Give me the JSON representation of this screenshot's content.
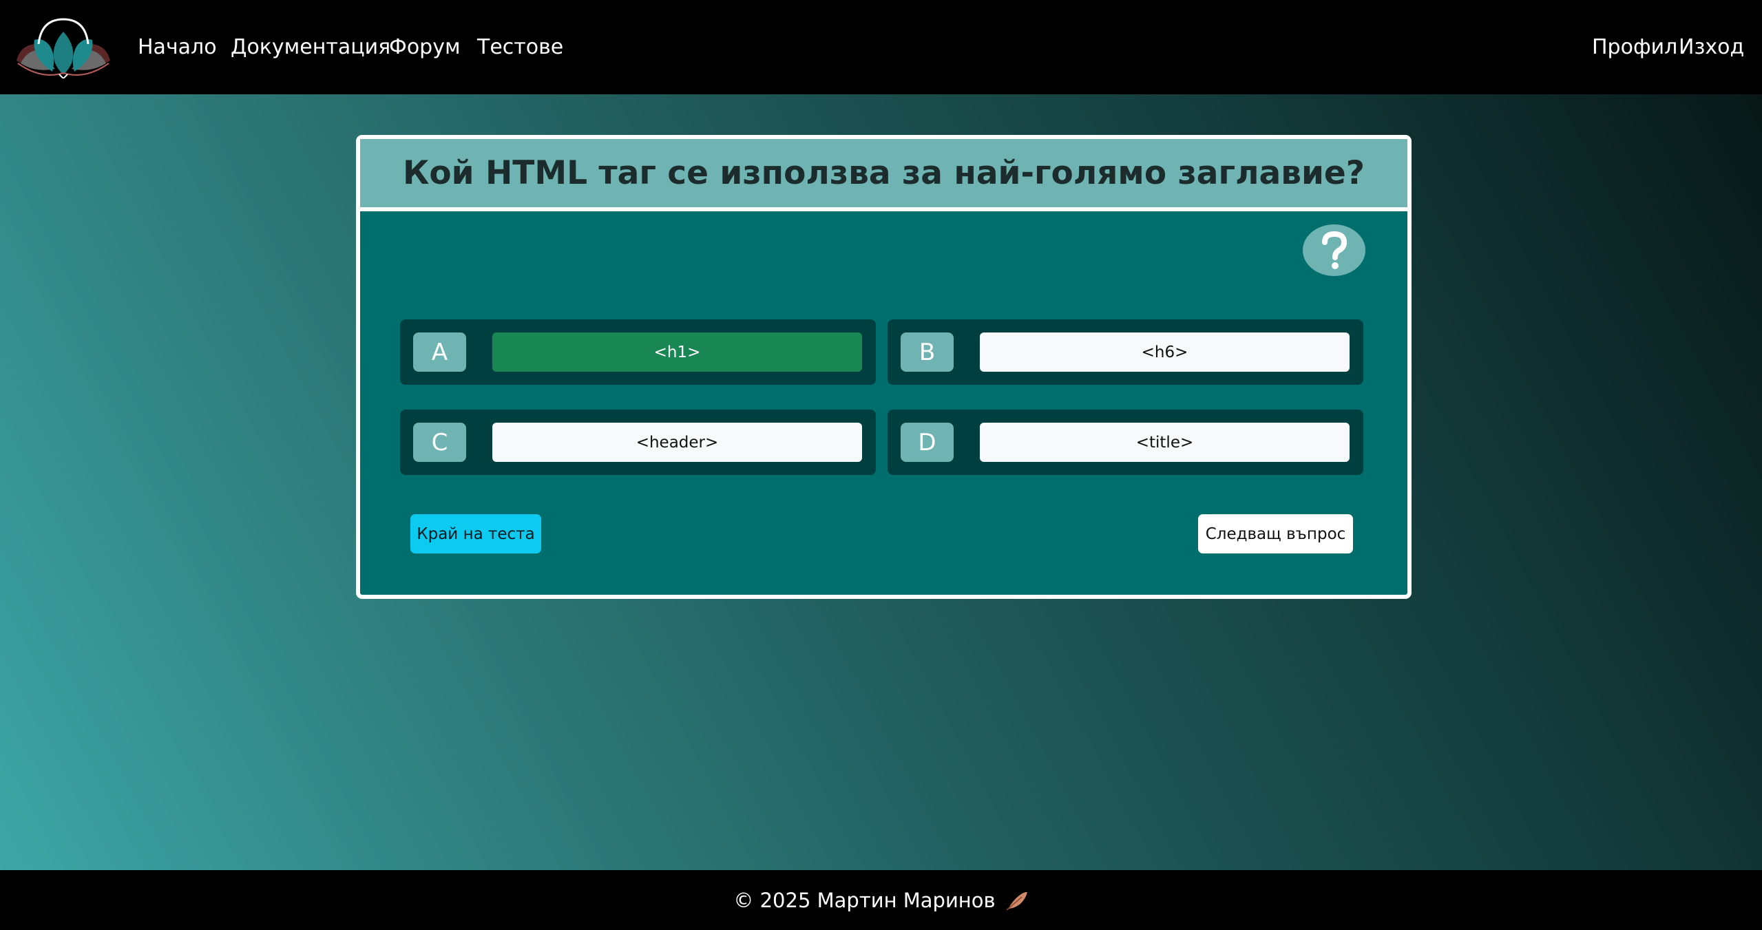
{
  "navbar": {
    "logo_icon": "lotus-logo-icon",
    "links": [
      "Начало",
      "Документация",
      "Форум",
      "Тестове"
    ],
    "right_links": [
      "Профил",
      "Изход"
    ]
  },
  "question": {
    "title": "Кой HTML таг се използва за най-голямо заглавие?",
    "help_icon": "question-mark-icon",
    "options": [
      {
        "letter": "A",
        "text": "<h1>",
        "state": "correct"
      },
      {
        "letter": "B",
        "text": "<h6>",
        "state": "default"
      },
      {
        "letter": "C",
        "text": "<header>",
        "state": "default"
      },
      {
        "letter": "D",
        "text": "<title>",
        "state": "default"
      }
    ],
    "end_button": "Край на теста",
    "next_button": "Следващ въпрос"
  },
  "footer": {
    "text": "© 2025 Мартин Маринов",
    "icon": "feather-icon"
  },
  "colors": {
    "nav_bg": "#000000",
    "card_bg": "#006e6d",
    "card_header_bg": "#6fb4b3",
    "option_bg": "#003f3f",
    "correct": "#198754",
    "end_button": "#0dcaf0"
  }
}
